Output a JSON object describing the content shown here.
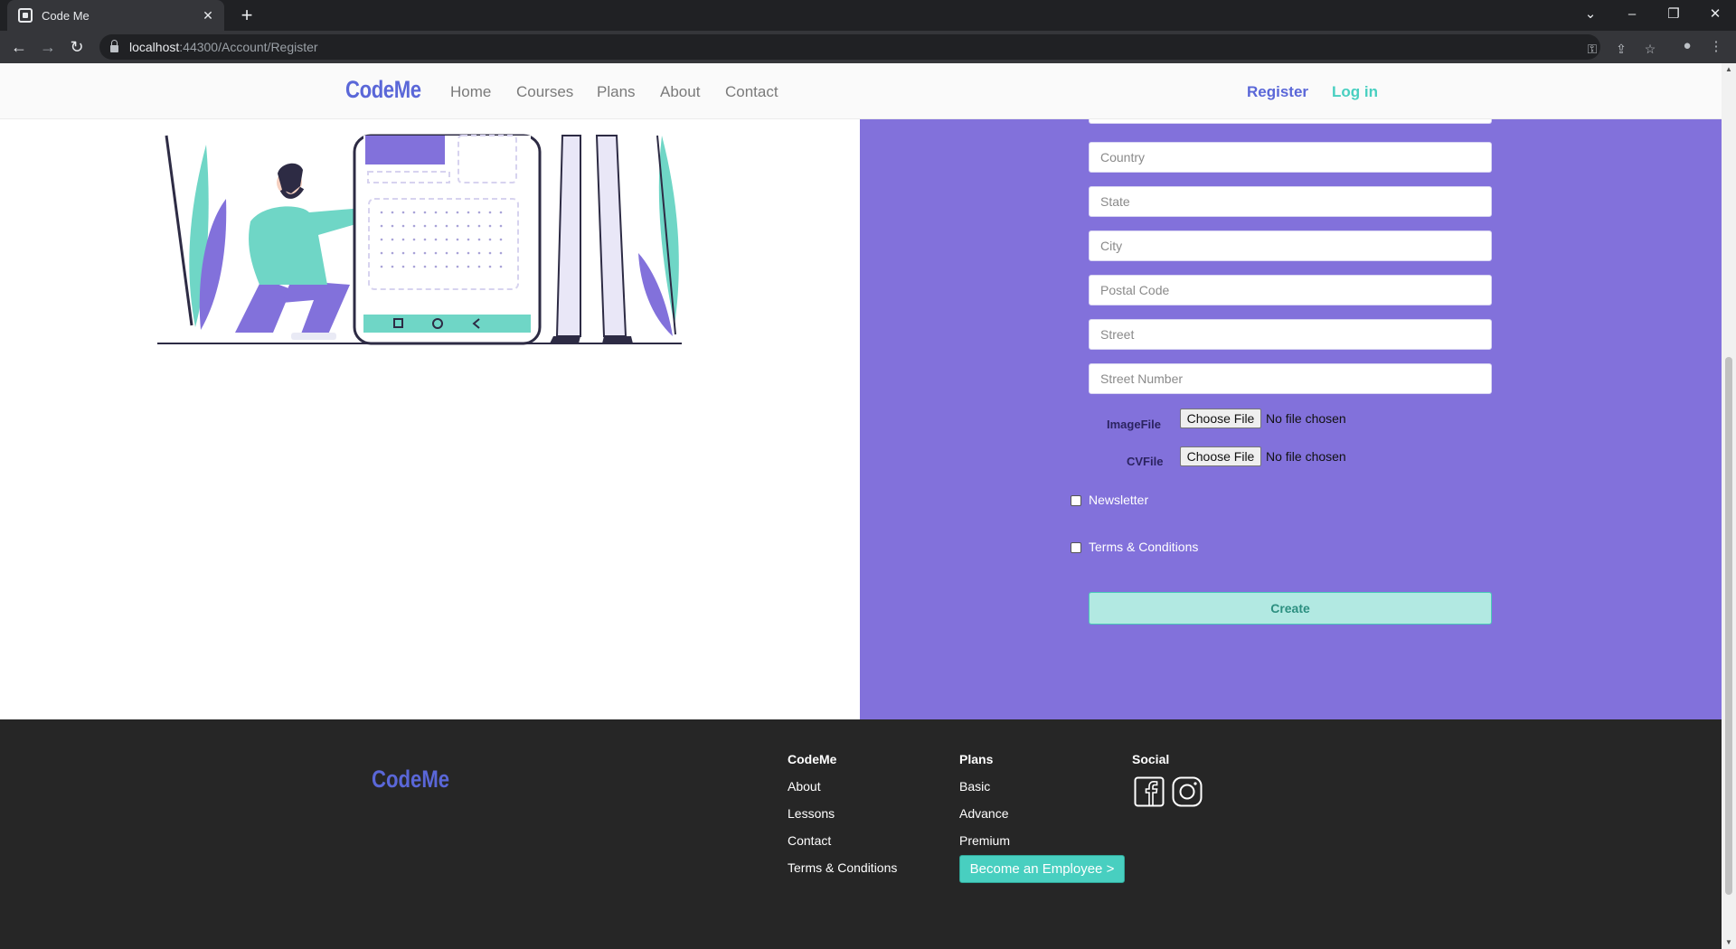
{
  "browser": {
    "tab_title": "Code Me",
    "url_host": "localhost",
    "url_rest": ":44300/Account/Register"
  },
  "nav": {
    "brand": "CodeMe",
    "links": [
      "Home",
      "Courses",
      "Plans",
      "About",
      "Contact"
    ],
    "register": "Register",
    "login": "Log in"
  },
  "form": {
    "fields": [
      {
        "name": "address-field",
        "placeholder": ""
      },
      {
        "name": "country-field",
        "placeholder": "Country"
      },
      {
        "name": "state-field",
        "placeholder": "State"
      },
      {
        "name": "city-field",
        "placeholder": "City"
      },
      {
        "name": "postal-code-field",
        "placeholder": "Postal Code"
      },
      {
        "name": "street-field",
        "placeholder": "Street"
      },
      {
        "name": "street-number-field",
        "placeholder": "Street Number"
      }
    ],
    "image_file_label": "ImageFile",
    "cv_file_label": "CVFile",
    "choose_file": "Choose File",
    "no_file": "No file chosen",
    "newsletter_label": "Newsletter",
    "terms_label": "Terms & Conditions",
    "create_label": "Create"
  },
  "footer": {
    "brand": "CodeMe",
    "col1": {
      "heading": "CodeMe",
      "links": [
        "About",
        "Lessons",
        "Contact",
        "Terms & Conditions"
      ]
    },
    "col2": {
      "heading": "Plans",
      "links": [
        "Basic",
        "Advance",
        "Premium"
      ]
    },
    "col3": {
      "heading": "Social",
      "icons": [
        "facebook-icon",
        "instagram-icon"
      ]
    },
    "employee_button": "Become an Employee >"
  },
  "colors": {
    "brand": "#5a67d8",
    "accent_teal": "#48cfc0",
    "panel_purple": "#8271db",
    "footer_bg": "#262626"
  }
}
